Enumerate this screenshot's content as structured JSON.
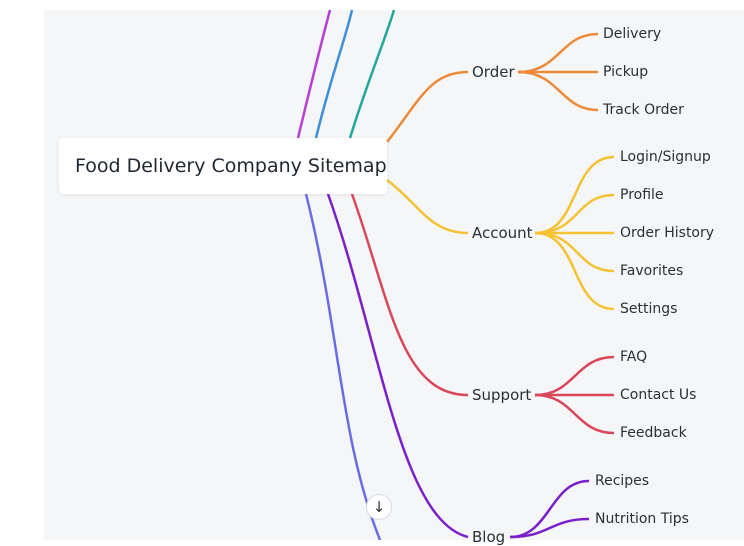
{
  "root": {
    "label": "Food Delivery Company Sitemap"
  },
  "scroll_button": {
    "icon": "arrow-down-icon",
    "glyph": "↓"
  },
  "branches": [
    {
      "key": "order",
      "label": "Order",
      "color": "#ec8a3a",
      "children": [
        "Delivery",
        "Pickup",
        "Track Order"
      ]
    },
    {
      "key": "account",
      "label": "Account",
      "color": "#f5c232",
      "children": [
        "Login/Signup",
        "Profile",
        "Order History",
        "Favorites",
        "Settings"
      ]
    },
    {
      "key": "support",
      "label": "Support",
      "color": "#d9485a",
      "children": [
        "FAQ",
        "Contact Us",
        "Feedback"
      ]
    },
    {
      "key": "blog",
      "label": "Blog",
      "color": "#7a1fc9",
      "children": [
        "Recipes",
        "Nutrition Tips"
      ]
    }
  ],
  "offscreen_branch_colors": [
    "#b83fd6",
    "#3e8fd9",
    "#23a89a",
    "#6a6ce6"
  ]
}
